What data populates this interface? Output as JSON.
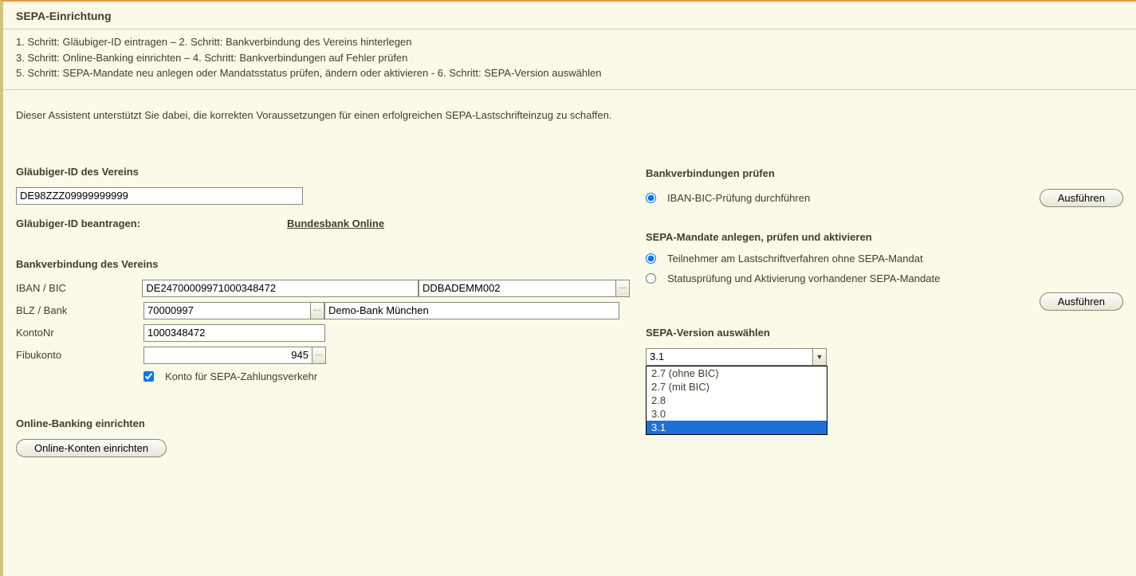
{
  "title": "SEPA-Einrichtung",
  "steps_lines": [
    "1. Schritt: Gläubiger-ID eintragen – 2. Schritt: Bankverbindung des Vereins hinterlegen",
    "3. Schritt: Online-Banking einrichten – 4. Schritt: Bankverbindungen auf Fehler prüfen",
    "5. Schritt: SEPA-Mandate neu anlegen oder Mandatsstatus prüfen, ändern oder aktivieren - 6. Schritt: SEPA-Version auswählen"
  ],
  "intro": "Dieser Assistent unterstützt Sie dabei, die korrekten Voraussetzungen für einen erfolgreichen SEPA-Lastschrifteinzug zu schaffen.",
  "left": {
    "glaubiger_head": "Gläubiger-ID des Vereins",
    "glaubiger_value": "DE98ZZZ09999999999",
    "request_label": "Gläubiger-ID beantragen:",
    "request_link": "Bundesbank Online",
    "bank_head": "Bankverbindung des Vereins",
    "iban_label": "IBAN / BIC",
    "iban_value": "DE24700009971000348472",
    "bic_value": "DDBADEMM002",
    "blz_label": "BLZ / Bank",
    "blz_value": "70000997",
    "bank_value": "Demo-Bank München",
    "konto_label": "KontoNr",
    "konto_value": "1000348472",
    "fibu_label": "Fibukonto",
    "fibu_value": "945",
    "sepa_check_label": "Konto für SEPA-Zahlungsverkehr",
    "online_head": "Online-Banking einrichten",
    "online_btn": "Online-Konten einrichten"
  },
  "right": {
    "head1": "Bankverbindungen prüfen",
    "radio1": "IBAN-BIC-Prüfung durchführen",
    "exec1": "Ausführen",
    "head2": "SEPA-Mandate anlegen, prüfen und aktivieren",
    "radio2a": "Teilnehmer am Lastschriftverfahren ohne SEPA-Mandat",
    "radio2b": "Statusprüfung und Aktivierung vorhandener SEPA-Mandate",
    "exec2": "Ausführen",
    "head3": "SEPA-Version auswählen",
    "sepa_version_value": "3.1",
    "sepa_options": [
      "2.7 (ohne BIC)",
      "2.7 (mit BIC)",
      "2.8",
      "3.0",
      "3.1"
    ]
  }
}
